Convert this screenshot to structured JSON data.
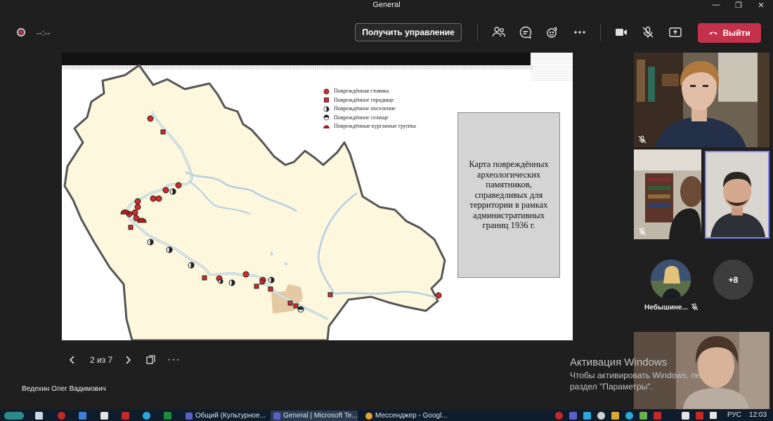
{
  "window": {
    "title": "General"
  },
  "toolbar": {
    "timer": "--:--",
    "take_control": "Получить управление",
    "leave": "Выйти",
    "accent": "#c4314b"
  },
  "slide": {
    "legend": [
      "Повреждённая стоянка",
      "Повреждённое городище",
      "Повреждённое поселение",
      "Повреждённое селище",
      "Повреждённые курганные группы"
    ],
    "caption": "Карта повреждённых археологических памятников, справедливых для территории в рамках административных границ 1936 г."
  },
  "navigation": {
    "count": "2 из 7",
    "more": "···"
  },
  "presenter": {
    "name": "Ведехин Олег Вадимович"
  },
  "participants": {
    "avatar_name": "Небышине...",
    "more": "+8"
  },
  "watermark": {
    "line1": "Активация Windows",
    "line2": "Чтобы активировать Windows, пе",
    "line3": "раздел \"Параметры\"."
  },
  "taskbar": {
    "apps": [
      "Общий (Культурное...",
      "General | Microsoft Te...",
      "Мессенджер - Googl..."
    ],
    "lang": "РУС",
    "time": "12:03"
  }
}
